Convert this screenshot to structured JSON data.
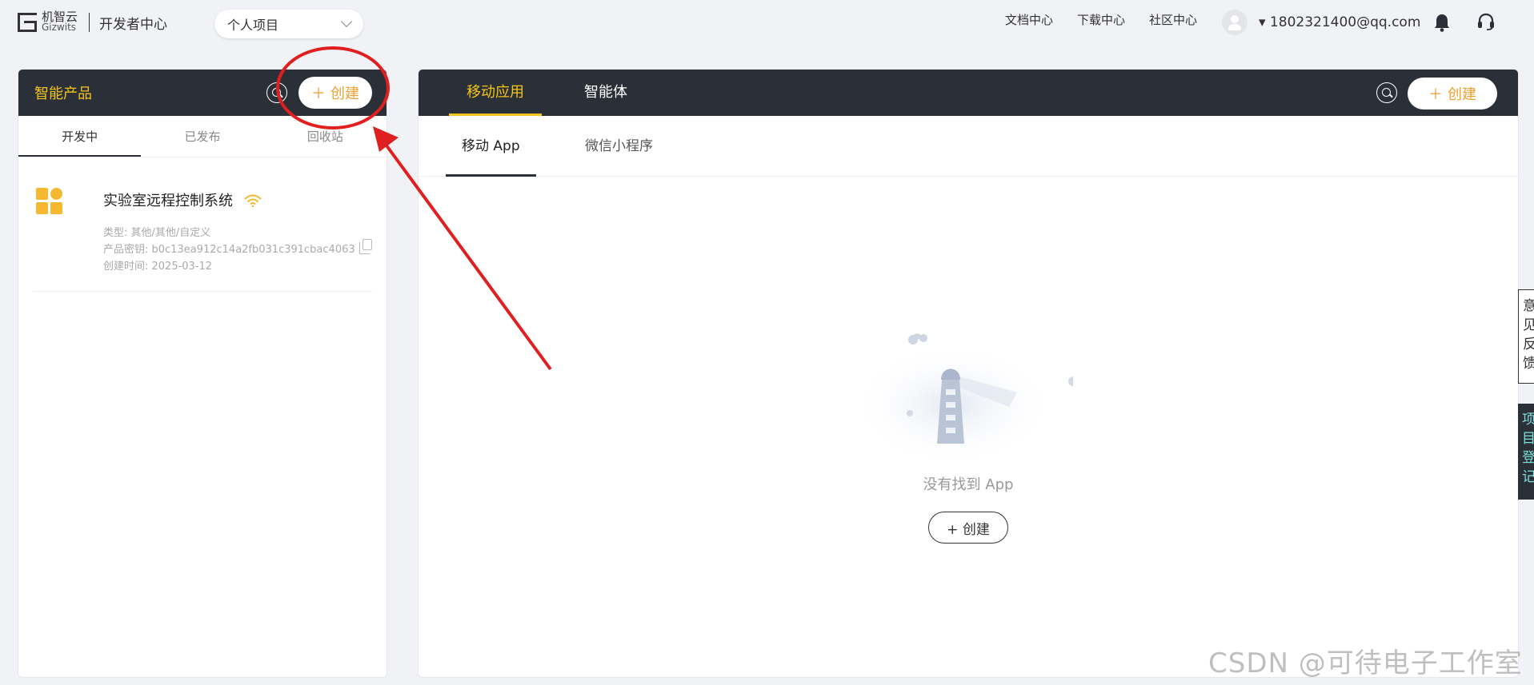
{
  "header": {
    "logo_cn": "机智云",
    "logo_en": "Gizwits",
    "portal_title": "开发者中心",
    "project_selector": "个人项目",
    "links": [
      "文档中心",
      "下载中心",
      "社区中心"
    ],
    "user_email": "▾ 1802321400@qq.com",
    "icons": [
      "bell-icon",
      "headset-icon"
    ]
  },
  "left_panel": {
    "title": "智能产品",
    "create_label": "创建",
    "tabs": [
      "开发中",
      "已发布",
      "回收站"
    ],
    "active_tab": "开发中",
    "products": [
      {
        "name": "实验室远程控制系统",
        "type": "类型: 其他/其他/自定义",
        "key": "产品密钥: b0c13ea912c14a2fb031c391cbac4063",
        "created": "创建时间: 2025-03-12"
      }
    ]
  },
  "right_panel": {
    "tabs": [
      "移动应用",
      "智能体"
    ],
    "active_tab": "移动应用",
    "create_label": "创建",
    "sub_tabs": [
      "移动 App",
      "微信小程序"
    ],
    "active_sub_tab": "移动 App",
    "empty_text": "没有找到 App",
    "empty_create_label": "+ 创建"
  },
  "side": {
    "feedback": "意见反馈",
    "register": "项目登记"
  },
  "watermark": "CSDN @可待电子工作室",
  "colors": {
    "header_bg": "#2b3038",
    "accent_yellow": "#f5c518",
    "create_orange": "#f0a030",
    "annotation_red": "#e02020"
  }
}
